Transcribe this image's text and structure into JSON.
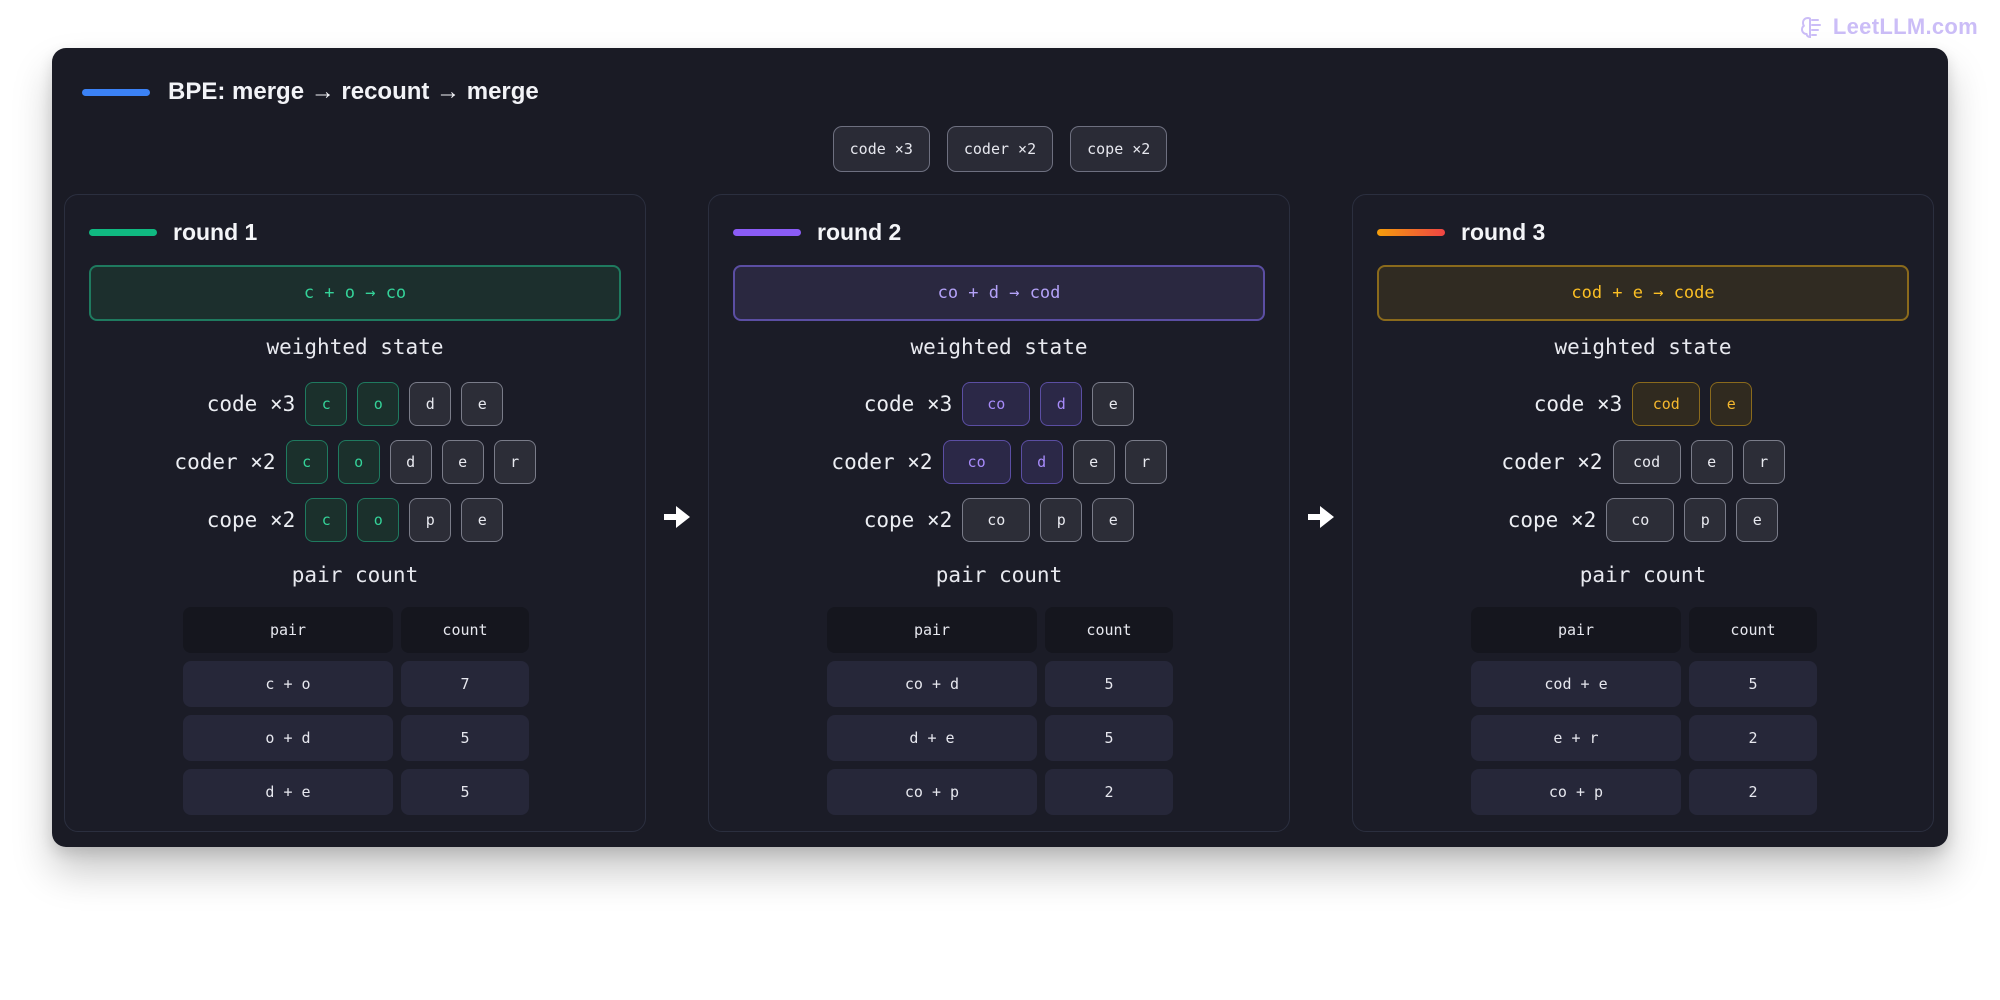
{
  "watermark": "LeetLLM.com",
  "title": "BPE: merge → recount → merge",
  "colors": {
    "title_accent": "#3b82f6",
    "round1": "#10b981",
    "round2": "#8b5cf6",
    "round3": "#f59e0b"
  },
  "word_counts": [
    "code ×3",
    "coder ×2",
    "cope ×2"
  ],
  "state_label": "weighted state",
  "pair_label": "pair count",
  "table_headers": {
    "pair": "pair",
    "count": "count"
  },
  "rounds": [
    {
      "title": "round 1",
      "merge": "c + o → co",
      "state": [
        {
          "word": "code ×3",
          "tokens": [
            "c",
            "o",
            "d",
            "e"
          ],
          "highlight": [
            0,
            1
          ]
        },
        {
          "word": "coder ×2",
          "tokens": [
            "c",
            "o",
            "d",
            "e",
            "r"
          ],
          "highlight": [
            0,
            1
          ]
        },
        {
          "word": "cope ×2",
          "tokens": [
            "c",
            "o",
            "p",
            "e"
          ],
          "highlight": [
            0,
            1
          ]
        }
      ],
      "pairs": [
        {
          "pair": "c + o",
          "count": "7"
        },
        {
          "pair": "o + d",
          "count": "5"
        },
        {
          "pair": "d + e",
          "count": "5"
        }
      ]
    },
    {
      "title": "round 2",
      "merge": "co + d → cod",
      "state": [
        {
          "word": "code ×3",
          "tokens": [
            "co",
            "d",
            "e"
          ],
          "highlight": [
            0,
            1
          ]
        },
        {
          "word": "coder ×2",
          "tokens": [
            "co",
            "d",
            "e",
            "r"
          ],
          "highlight": [
            0,
            1
          ]
        },
        {
          "word": "cope ×2",
          "tokens": [
            "co",
            "p",
            "e"
          ],
          "highlight": []
        }
      ],
      "pairs": [
        {
          "pair": "co + d",
          "count": "5"
        },
        {
          "pair": "d + e",
          "count": "5"
        },
        {
          "pair": "co + p",
          "count": "2"
        }
      ]
    },
    {
      "title": "round 3",
      "merge": "cod + e → code",
      "state": [
        {
          "word": "code ×3",
          "tokens": [
            "cod",
            "e"
          ],
          "highlight": [
            0,
            1
          ]
        },
        {
          "word": "coder ×2",
          "tokens": [
            "cod",
            "e",
            "r"
          ],
          "highlight": []
        },
        {
          "word": "cope ×2",
          "tokens": [
            "co",
            "p",
            "e"
          ],
          "highlight": []
        }
      ],
      "pairs": [
        {
          "pair": "cod + e",
          "count": "5"
        },
        {
          "pair": "e + r",
          "count": "2"
        },
        {
          "pair": "co + p",
          "count": "2"
        }
      ]
    }
  ]
}
